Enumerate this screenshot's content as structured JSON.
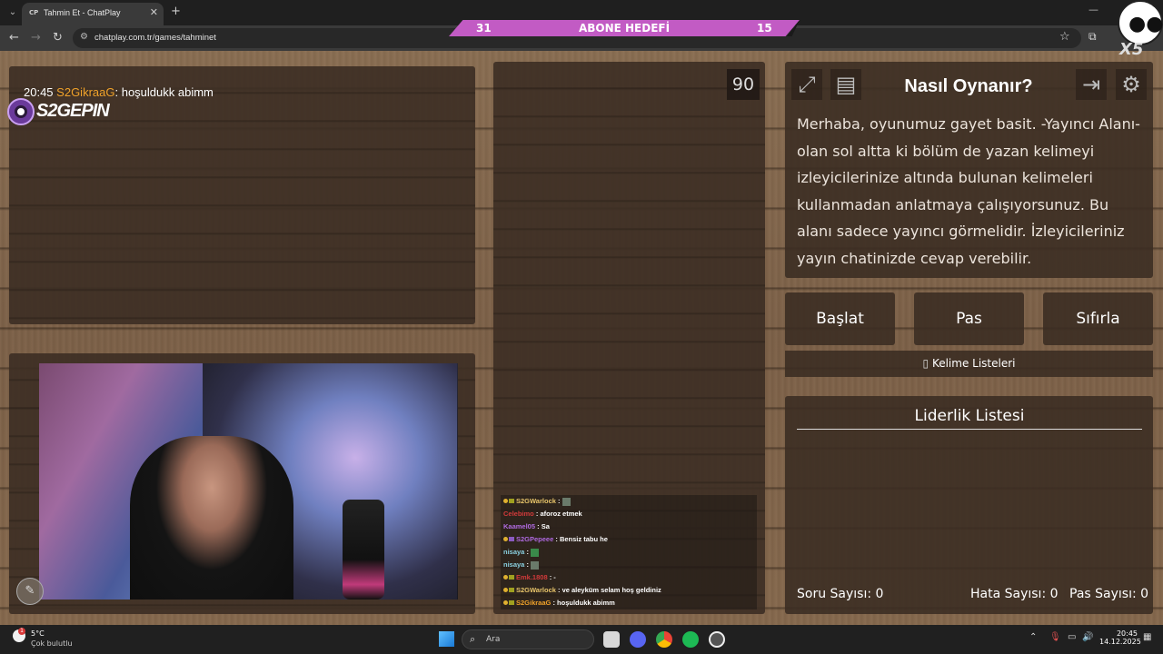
{
  "browser": {
    "tab_title": "Tahmin Et - ChatPlay",
    "tab_favicon": "CP",
    "url": "chatplay.com.tr/games/tahminet"
  },
  "goal_banner": {
    "left_value": "31",
    "title": "ABONE HEDEFİ",
    "right_value": "15",
    "color": "#c25bc4"
  },
  "overlay": {
    "time": "20:45",
    "user": "S2GikraaG",
    "message": ": hoşuldukk abimm",
    "brand": "S2GEPIN",
    "user_color": "#f0a22a"
  },
  "timer": "90",
  "chat": [
    {
      "user": "S2GWarlock",
      "text": " :",
      "color": "#e8c56a"
    },
    {
      "user": "Celebimo",
      "text": ": aforoz etmek",
      "color": "#d23a3a"
    },
    {
      "user": "Kaamel05",
      "text": ": Sa",
      "color": "#b06ae0"
    },
    {
      "user": "S2GPepeee",
      "text": ": Bensiz tabu he",
      "color": "#b06ae0"
    },
    {
      "user": "nisaya",
      "text": ":",
      "color": "#8ad0e0"
    },
    {
      "user": "nisaya",
      "text": ":",
      "color": "#8ad0e0"
    },
    {
      "user": "Emk.1808",
      "text": ": -",
      "color": "#d23a3a"
    },
    {
      "user": "S2GWarlock",
      "text": ": ve aleyküm selam hoş geldiniz",
      "color": "#e8c56a"
    },
    {
      "user": "S2GikraaG",
      "text": ": hoşuldukk abimm",
      "color": "#f0a22a"
    }
  ],
  "howto": {
    "title": "Nasıl Oynanır?",
    "text": "Merhaba, oyunumuz gayet basit. -Yayıncı Alanı- olan sol altta ki bölüm de yazan kelimeyi izleyicilerinize altında bulunan kelimeleri kullanmadan anlatmaya çalışıyorsunuz. Bu alanı sadece yayıncı görmelidir. İzleyicileriniz yayın chatinizde cevap verebilir."
  },
  "buttons": {
    "start": "Başlat",
    "pass": "Pas",
    "reset": "Sıfırla",
    "word_lists": "Kelime Listeleri"
  },
  "leaderboard": {
    "title": "Liderlik Listesi",
    "question_count": "Soru Sayısı: 0",
    "error_count": "Hata Sayısı: 0",
    "pass_count": "Pas Sayısı: 0"
  },
  "taskbar": {
    "temperature": "5°C",
    "weather": "Çok bulutlu",
    "weather_badge": "1",
    "search_placeholder": "Ara",
    "time": "20:45",
    "date": "14.12.2025"
  }
}
